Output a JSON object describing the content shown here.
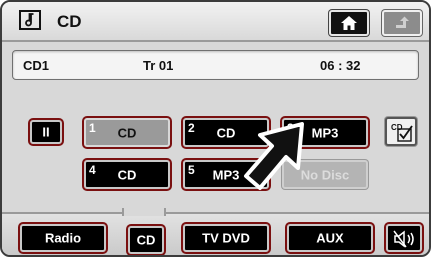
{
  "header": {
    "source_icon": "music-note-icon",
    "title": "CD",
    "home_icon": "home-icon",
    "back_icon": "back-arrow-icon"
  },
  "info": {
    "disc": "CD1",
    "track": "Tr 01",
    "time": "06 : 32"
  },
  "controls": {
    "pause_label": "II",
    "eject_icon": "cd-eject-check-icon"
  },
  "slots": [
    {
      "num": "1",
      "label": "CD"
    },
    {
      "num": "2",
      "label": "CD"
    },
    {
      "num": "3",
      "label": "MP3"
    },
    {
      "num": "4",
      "label": "CD"
    },
    {
      "num": "5",
      "label": "MP3"
    },
    {
      "num": "",
      "label": "No Disc"
    }
  ],
  "sources": {
    "radio": "Radio",
    "cd": "CD",
    "tvdvd": "TV DVD",
    "aux": "AUX",
    "mute_icon": "speaker-mute-icon"
  },
  "colors": {
    "selected_slot": "#9a9a9a",
    "active_border": "#7a1010",
    "button_black": "#000000"
  }
}
